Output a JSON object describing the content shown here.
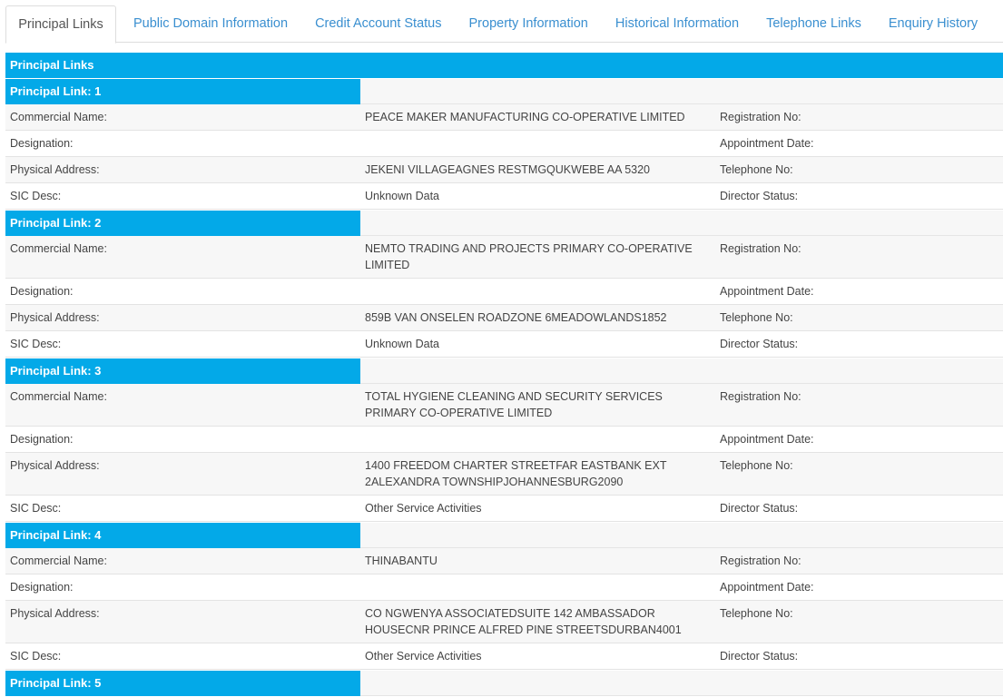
{
  "tabs": [
    {
      "label": "Principal Links",
      "active": true
    },
    {
      "label": "Public Domain Information",
      "active": false
    },
    {
      "label": "Credit Account Status",
      "active": false
    },
    {
      "label": "Property Information",
      "active": false
    },
    {
      "label": "Historical Information",
      "active": false
    },
    {
      "label": "Telephone Links",
      "active": false
    },
    {
      "label": "Enquiry History",
      "active": false
    }
  ],
  "section_title": "Principal Links",
  "labels": {
    "commercial_name": "Commercial Name:",
    "designation": "Designation:",
    "physical_address": "Physical Address:",
    "sic_desc": "SIC Desc:",
    "registration_no": "Registration No:",
    "appointment_date": "Appointment Date:",
    "telephone_no": "Telephone No:",
    "director_status": "Director Status:"
  },
  "links": [
    {
      "title": "Principal Link: 1",
      "commercial_name": "PEACE MAKER MANUFACTURING CO-OPERATIVE LIMITED",
      "designation": "",
      "physical_address": "JEKENI VILLAGEAGNES RESTMGQUKWEBE AA 5320",
      "sic_desc": "Unknown Data"
    },
    {
      "title": "Principal Link: 2",
      "commercial_name": "NEMTO TRADING AND PROJECTS PRIMARY CO-OPERATIVE LIMITED",
      "designation": "",
      "physical_address": "859B VAN ONSELEN ROADZONE 6MEADOWLANDS1852",
      "sic_desc": "Unknown Data"
    },
    {
      "title": "Principal Link: 3",
      "commercial_name": "TOTAL HYGIENE CLEANING AND SECURITY SERVICES PRIMARY CO-OPERATIVE LIMITED",
      "designation": "",
      "physical_address": "1400 FREEDOM CHARTER STREETFAR EASTBANK EXT 2ALEXANDRA TOWNSHIPJOHANNESBURG2090",
      "sic_desc": "Other Service Activities"
    },
    {
      "title": "Principal Link: 4",
      "commercial_name": "THINABANTU",
      "designation": "",
      "physical_address": "CO NGWENYA ASSOCIATEDSUITE 142 AMBASSADOR HOUSECNR PRINCE ALFRED PINE STREETSDURBAN4001",
      "sic_desc": "Other Service Activities"
    },
    {
      "title": "Principal Link: 5"
    }
  ],
  "colors": {
    "header_blue": "#03a9e8",
    "tab_link": "#3a8fd0",
    "row_alt": "#f7f7f7"
  }
}
